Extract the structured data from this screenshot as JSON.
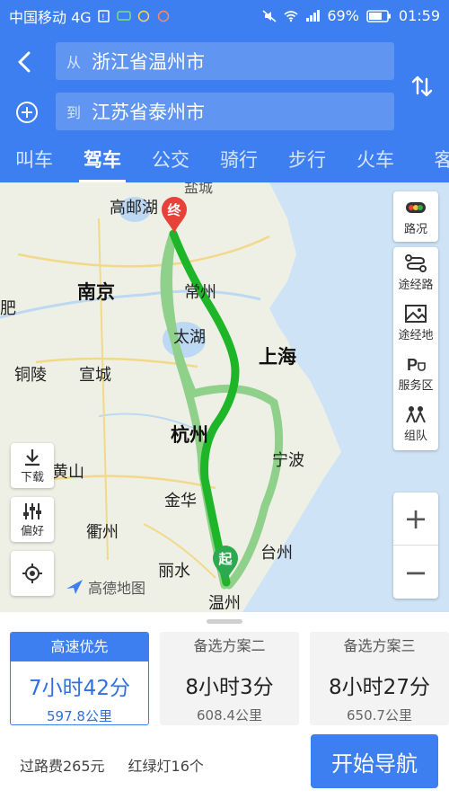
{
  "status_bar": {
    "carrier": "中国移动 4G",
    "battery": "69%",
    "time": "01:59"
  },
  "route": {
    "from_prefix": "从",
    "from": "浙江省温州市",
    "to_prefix": "到",
    "to": "江苏省泰州市"
  },
  "tabs": [
    {
      "label": "叫车"
    },
    {
      "label": "驾车"
    },
    {
      "label": "公交"
    },
    {
      "label": "骑行"
    },
    {
      "label": "步行"
    },
    {
      "label": "火车"
    },
    {
      "label": "客"
    }
  ],
  "map": {
    "cities": {
      "gaoyouhu": "高邮湖",
      "yancheng": "盐城",
      "nanjing": "南京",
      "changzhou": "常州",
      "taihu": "太湖",
      "shanghai": "上海",
      "tongling": "铜陵",
      "xuancheng": "宣城",
      "hangzhou": "杭州",
      "ningbo": "宁波",
      "huangshan": "黄山",
      "jinhua": "金华",
      "quzhou": "衢州",
      "taizhou": "台州",
      "lishui": "丽水",
      "wenzhou": "温州",
      "fei": "肥"
    },
    "markers": {
      "end": "终",
      "start": "起"
    },
    "side_tools": [
      {
        "label": "路况",
        "icon": "traffic-icon"
      },
      {
        "label": "途经路",
        "icon": "route-via-icon"
      },
      {
        "label": "途经地",
        "icon": "waypoint-icon"
      },
      {
        "label": "服务区",
        "icon": "service-area-icon"
      },
      {
        "label": "组队",
        "icon": "team-icon"
      }
    ],
    "download_label": "下载",
    "preference_label": "偏好",
    "zoom_in": "+",
    "zoom_out": "−",
    "logo_text": "高德地图"
  },
  "plans": [
    {
      "header": "高速优先",
      "time": "7小时42分",
      "distance": "597.8公里",
      "active": true
    },
    {
      "header": "备选方案二",
      "time": "8小时3分",
      "distance": "608.4公里",
      "active": false
    },
    {
      "header": "备选方案三",
      "time": "8小时27分",
      "distance": "650.7公里",
      "active": false
    }
  ],
  "footer": {
    "toll": "过路费265元",
    "lights": "红绿灯16个",
    "start_nav": "开始导航"
  },
  "colors": {
    "primary": "#3d7ef0",
    "route_main": "#1fb529",
    "route_alt": "#8fd08a",
    "marker_red": "#e8413a",
    "marker_green": "#2daa4f",
    "sea": "#cfe3f7"
  }
}
